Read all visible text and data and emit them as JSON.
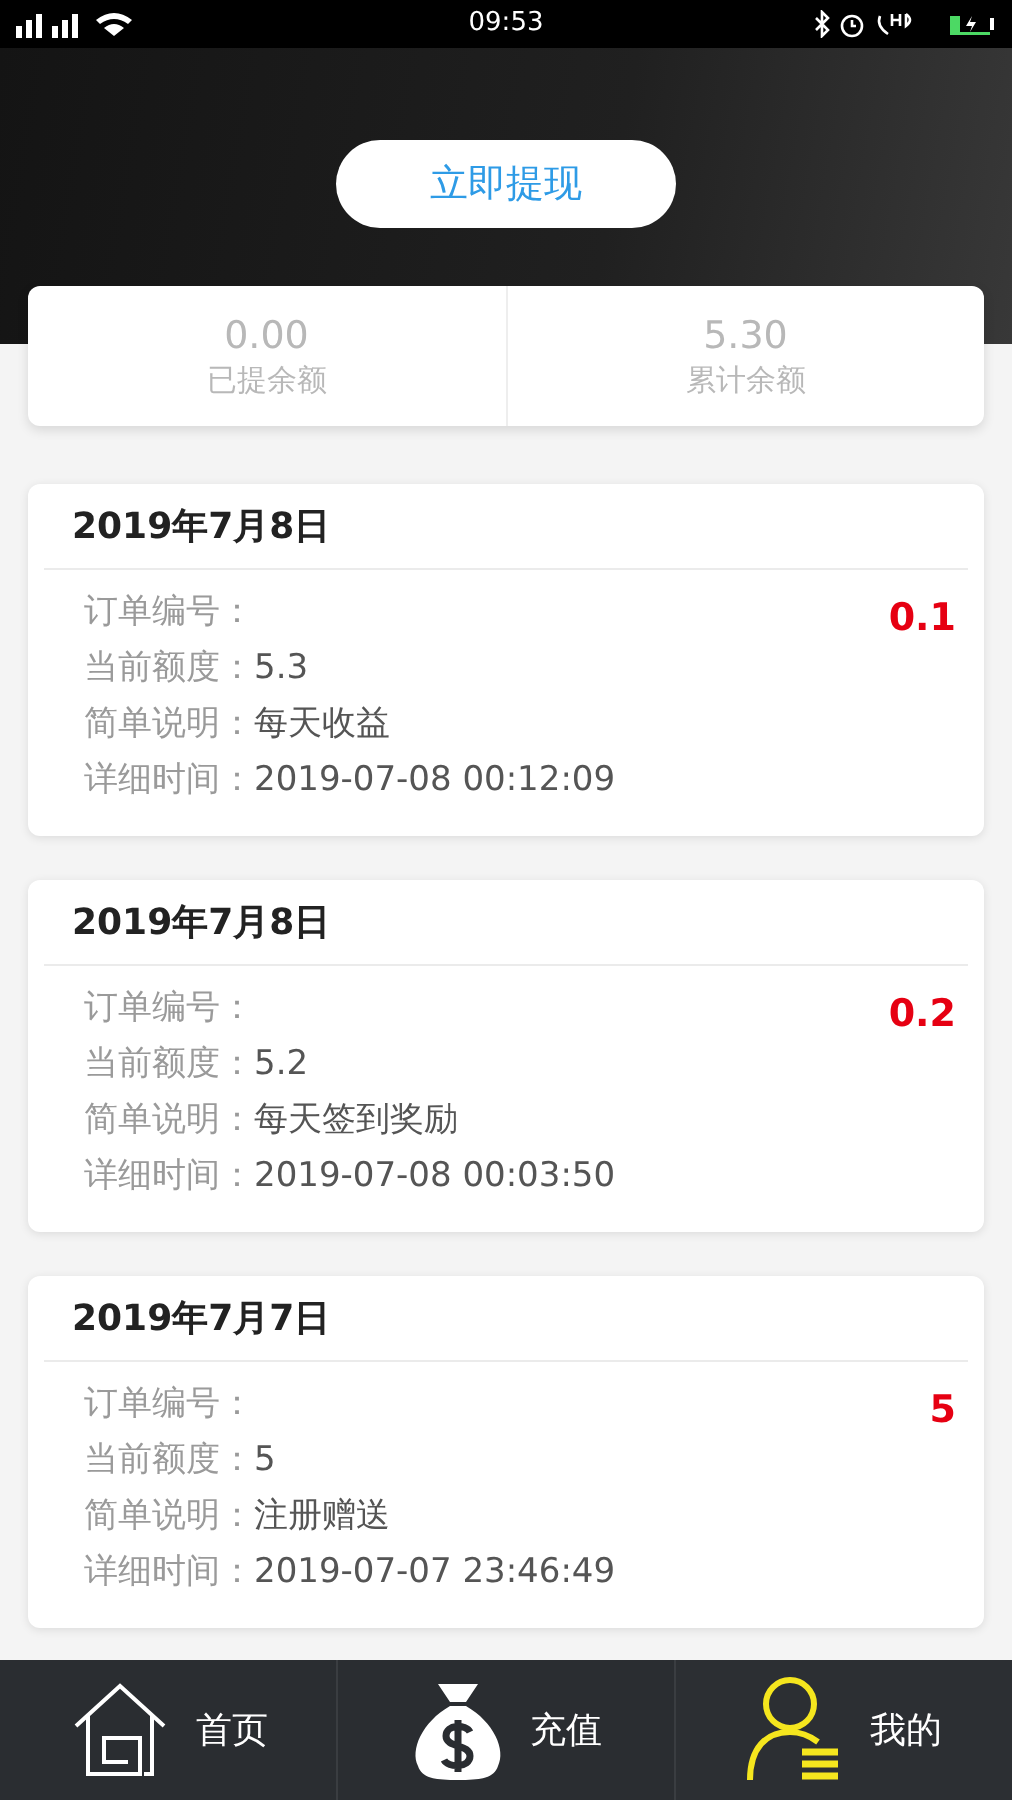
{
  "status_bar": {
    "time": "09:53"
  },
  "header": {
    "withdraw_button": "立即提现"
  },
  "summary": [
    {
      "value": "0.00",
      "label": "已提余额"
    },
    {
      "value": "5.30",
      "label": "累计余额"
    }
  ],
  "records": [
    {
      "date": "2019年7月8日",
      "amount": "0.1",
      "fields": [
        {
          "label": "订单编号："
        },
        {
          "label": "当前额度：",
          "value": "5.3"
        },
        {
          "label": "简单说明：",
          "value": "每天收益"
        },
        {
          "label": "详细时间：",
          "value": "2019-07-08 00:12:09"
        }
      ]
    },
    {
      "date": "2019年7月8日",
      "amount": "0.2",
      "fields": [
        {
          "label": "订单编号："
        },
        {
          "label": "当前额度：",
          "value": "5.2"
        },
        {
          "label": "简单说明：",
          "value": "每天签到奖励"
        },
        {
          "label": "详细时间：",
          "value": "2019-07-08 00:03:50"
        }
      ]
    },
    {
      "date": "2019年7月7日",
      "amount": "5",
      "fields": [
        {
          "label": "订单编号："
        },
        {
          "label": "当前额度：",
          "value": "5"
        },
        {
          "label": "简单说明：",
          "value": "注册赠送"
        },
        {
          "label": "详细时间：",
          "value": "2019-07-07 23:46:49"
        }
      ]
    }
  ],
  "tab_bar": [
    {
      "kind": "home",
      "label": "首页",
      "selected": false
    },
    {
      "kind": "recharge",
      "label": "充值",
      "selected": false
    },
    {
      "kind": "profile",
      "label": "我的",
      "selected": true
    }
  ]
}
